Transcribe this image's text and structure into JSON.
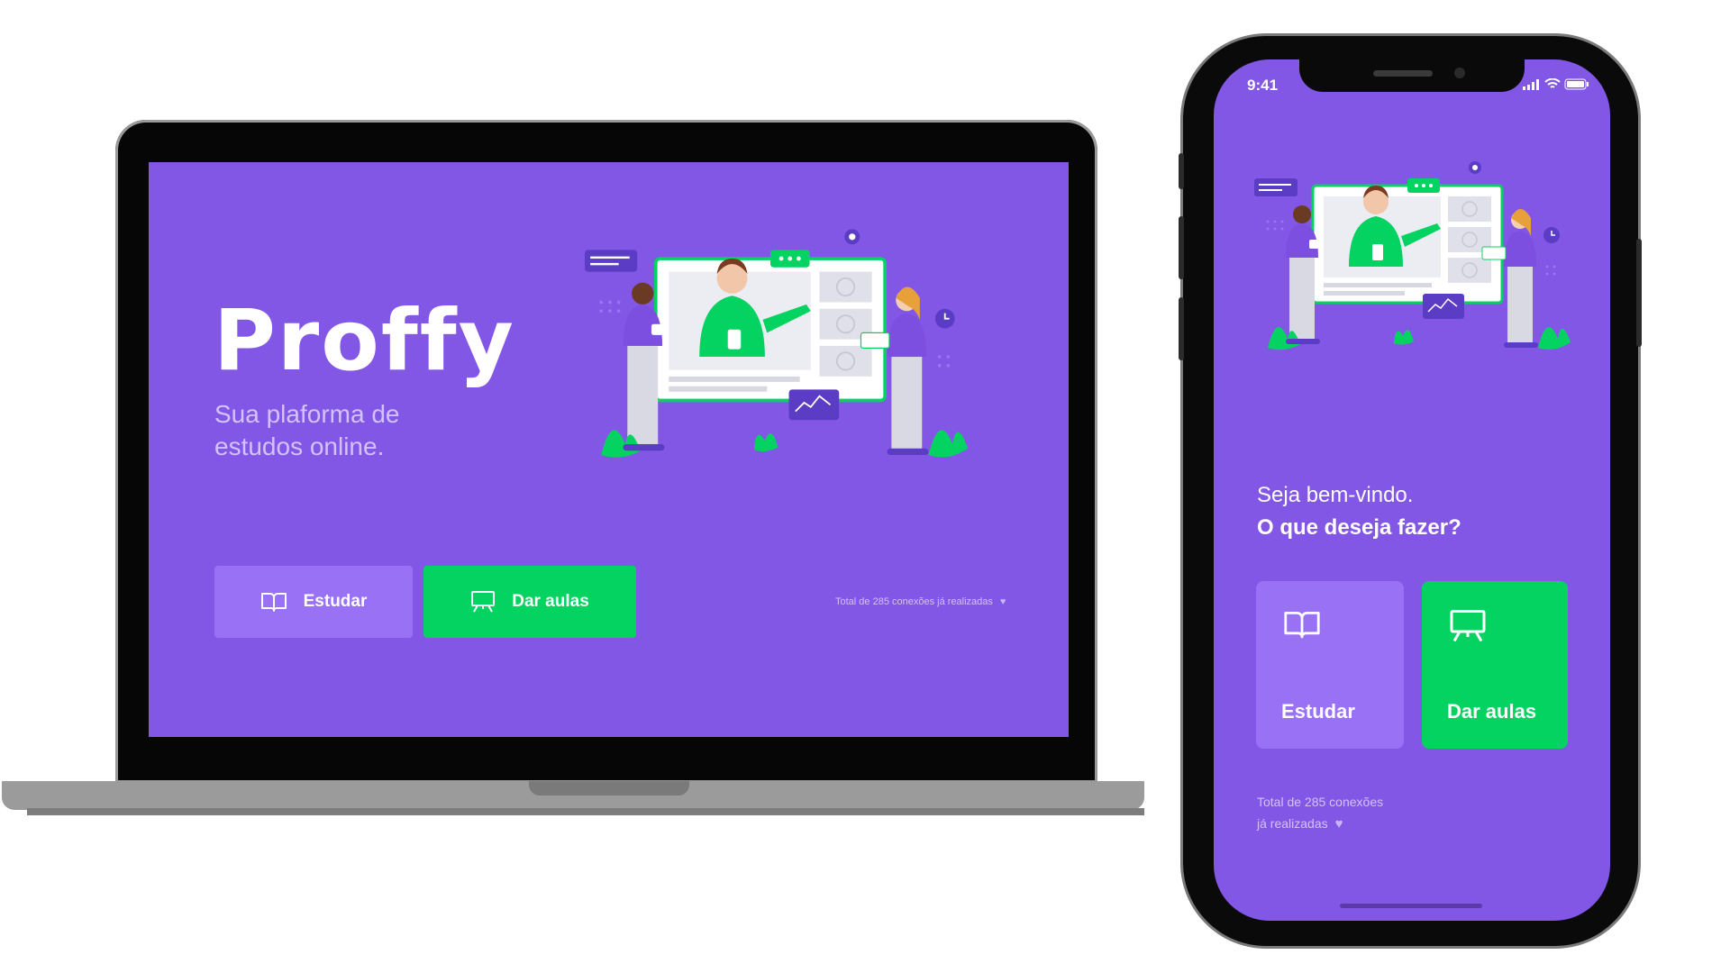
{
  "desktop": {
    "logo": "Proffy",
    "tagline": "Sua plaforma de estudos online.",
    "buttons": {
      "study": "Estudar",
      "teach": "Dar aulas"
    },
    "total_connections": "Total de 285 conexões já realizadas"
  },
  "mobile": {
    "status": {
      "time": "9:41"
    },
    "welcome": "Seja bem-vindo.",
    "question": "O que deseja fazer?",
    "buttons": {
      "study": "Estudar",
      "teach": "Dar aulas"
    },
    "total_line1": "Total de 285 conexões",
    "total_line2": "já realizadas"
  },
  "colors": {
    "primary": "#8257e5",
    "primary_light": "#9871f5",
    "secondary": "#04d361",
    "text_light": "#d4c2ff",
    "device_frame": "#060606"
  },
  "icons": [
    "book-open-icon",
    "presentation-board-icon",
    "heart-icon",
    "gear-icon",
    "clock-icon",
    "chat-bubble-icon",
    "play-icon",
    "wifi-icon",
    "signal-icon",
    "battery-icon"
  ]
}
